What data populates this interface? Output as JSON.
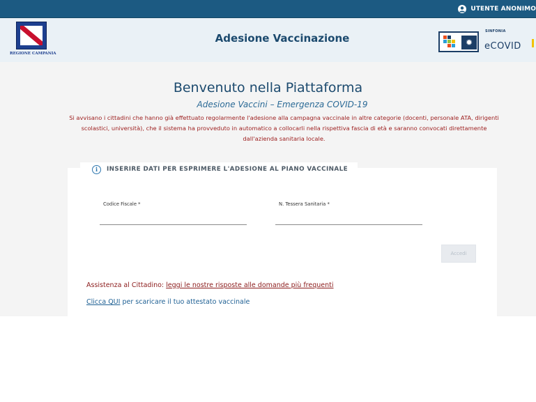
{
  "topbar": {
    "user_label": "UTENTE ANONIMO",
    "user_icon": "user-icon"
  },
  "header": {
    "title": "Adesione Vaccinazione",
    "region_logo_text": "REGIONE CAMPANIA",
    "partner_small": "SINFONIA",
    "partner_name": "eCOVID"
  },
  "main": {
    "welcome": "Benvenuto nella Piattaforma",
    "subtitle": "Adesione Vaccini – Emergenza COVID-19",
    "notice": "Si avvisano i cittadini che hanno già effettuato regolarmente l'adesione alla campagna vaccinale in altre categorie (docenti, personale ATA, dirigenti scolastici, università), che il sistema ha provveduto in automatico a collocarli nella rispettiva fascia di età e saranno convocati direttamente dall'azienda sanitaria locale."
  },
  "form": {
    "title": "INSERIRE DATI PER ESPRIMERE L'ADESIONE AL PIANO VACCINALE",
    "info_icon": "info-icon",
    "codice_fiscale_label": "Codice Fiscale *",
    "codice_fiscale_value": "",
    "tessera_label": "N. Tessera Sanitaria *",
    "tessera_value": "",
    "submit_label": "Accedi"
  },
  "links": {
    "assist_prefix": "Assistenza al Cittadino:",
    "assist_link": "leggi le nostre risposte alle domande più frequenti",
    "download_link": "Clicca QUI",
    "download_suffix": "per scaricare il tuo attestato vaccinale"
  },
  "colors": {
    "topbar": "#1c5a82",
    "header_bg": "#eaf1f6",
    "title_blue": "#1c4a6e",
    "notice_red": "#9c1c1c"
  }
}
